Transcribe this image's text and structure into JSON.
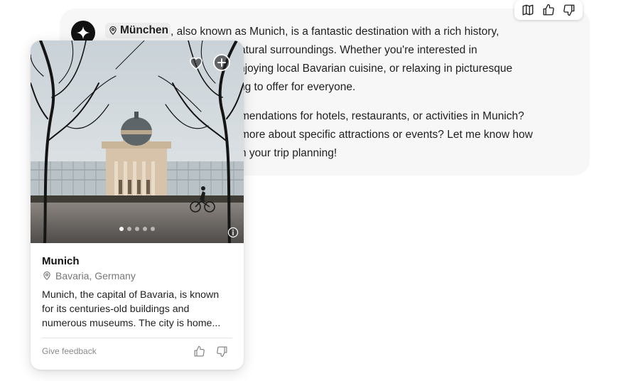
{
  "message": {
    "place_chip_label": "München",
    "lines": [
      ", also known as Munich, is a fantastic destination with a rich history,",
      "ul natural surroundings. Whether you're interested in",
      "njoying local Bavarian cuisine, or relaxing in picturesque",
      "ng to offer for everyone.",
      "mendations for hotels, restaurants, or activities in Munich?",
      "more about specific attractions or events? Let me know how",
      "n your trip planning!"
    ]
  },
  "actions": {
    "icons": [
      "map-icon",
      "thumbs-up-icon",
      "thumbs-down-icon"
    ]
  },
  "place_card": {
    "title": "Munich",
    "location": "Bavaria, Germany",
    "description_lines": [
      "Munich, the capital of Bavaria, is known",
      "for its centuries-old buildings and",
      "numerous museums. The city is home..."
    ],
    "image_count": 5,
    "active_image_index": 0,
    "feedback_label": "Give feedback"
  },
  "colors": {
    "bubble_bg": "#f7f7f7",
    "avatar_bg": "#111111",
    "chip_bg": "#ececec",
    "muted_text": "#777777"
  }
}
